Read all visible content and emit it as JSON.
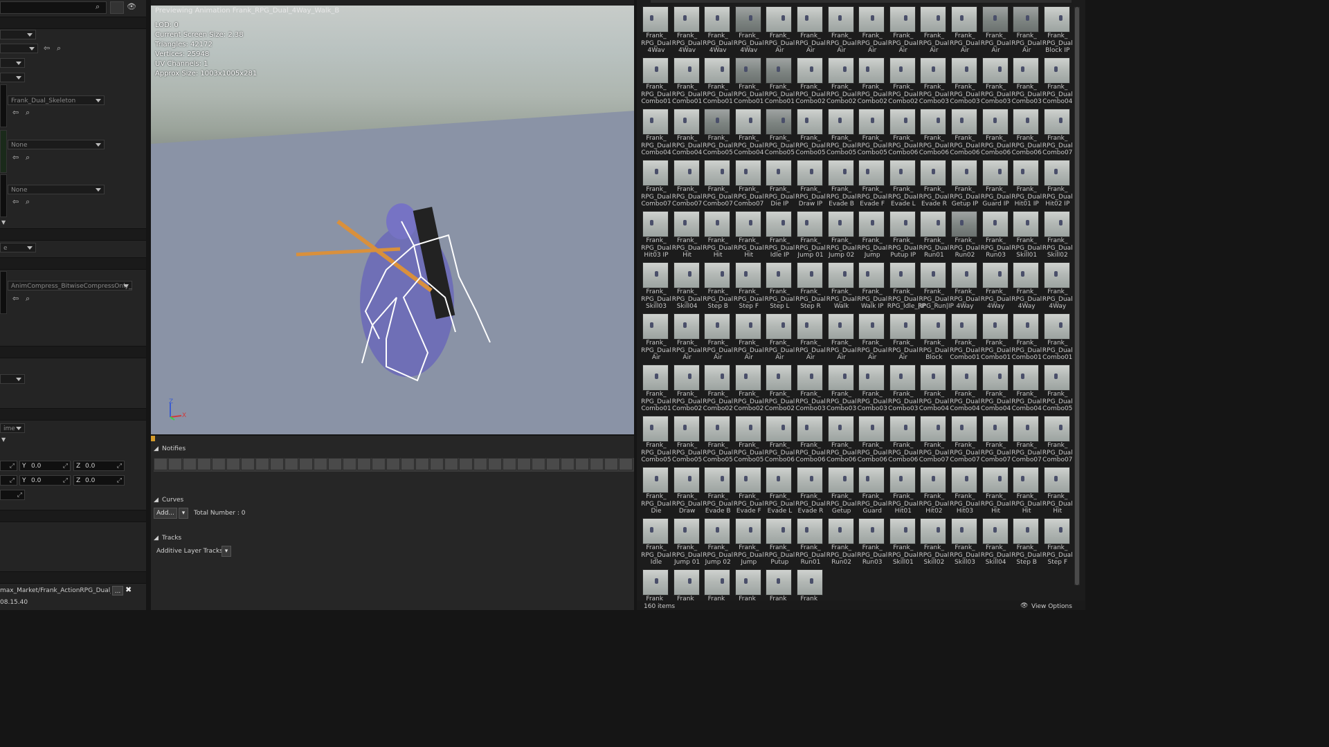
{
  "details": {
    "skeleton_value": "Frank_Dual_Skeleton",
    "none1": "None",
    "none2": "None",
    "compression_value": "AnimCompress_BitwiseCompressOnly_",
    "time_dropdown": "ime",
    "y1": "0.0",
    "z1": "0.0",
    "y2": "0.0",
    "z2": "0.0",
    "y_label": "Y",
    "z_label": "Z",
    "asset_path": "max_Market/Frank_ActionRPG_Dual_M",
    "timestamp": "08.15.40",
    "close_glyph": "✖",
    "browse_glyph": "..."
  },
  "viewport": {
    "title": "Previewing Animation Frank_RPG_Dual_4Way_Walk_B",
    "stats": [
      "LOD: 0",
      "Current Screen Size: 2.38",
      "Triangles: 42172",
      "Vertices: 25948",
      "UV Channels: 1",
      "Approx Size: 1003x1005x281"
    ],
    "axis": {
      "z": "Z",
      "x": "X"
    }
  },
  "anim": {
    "notifies": "Notifies",
    "curves": "Curves",
    "add": "Add...",
    "total": "Total Number : 0",
    "tracks": "Tracks",
    "additive": "Additive Layer Tracks"
  },
  "browser": {
    "item_count": "160 items",
    "view_options": "View Options",
    "tiles": [
      [
        "4Wav",
        "4Wav",
        "4Wav",
        "4Wav",
        "Air",
        "Air",
        "Air",
        "Air",
        "Air",
        "Air",
        "Air",
        "Air",
        "Air",
        "Block IP"
      ],
      [
        "Combo01",
        "Combo01",
        "Combo01",
        "Combo01",
        "Combo01",
        "Combo02",
        "Combo02",
        "Combo02",
        "Combo02",
        "Combo03",
        "Combo03",
        "Combo03",
        "Combo03",
        "Combo04"
      ],
      [
        "Combo04",
        "Combo04",
        "Combo05",
        "Combo04",
        "Combo05",
        "Combo05",
        "Combo05",
        "Combo05",
        "Combo06",
        "Combo06",
        "Combo06",
        "Combo06",
        "Combo06",
        "Combo07"
      ],
      [
        "Combo07",
        "Combo07",
        "Combo07",
        "Combo07",
        "Die IP",
        "Draw IP",
        "Evade B",
        "Evade F",
        "Evade L",
        "Evade R",
        "Getup IP",
        "Guard IP",
        "Hit01 IP",
        "Hit02 IP"
      ],
      [
        "Hit03 IP",
        "Hit",
        "Hit",
        "Hit",
        "Idle IP",
        "Jump 01",
        "Jump 02",
        "Jump",
        "Putup IP",
        "Run01",
        "Run02",
        "Run03",
        "Skill01",
        "Skill02"
      ],
      [
        "Skill03",
        "Skill04",
        "Step B",
        "Step F",
        "Step L",
        "Step R",
        "Walk",
        "Walk IP",
        "RPG_Idle_|IP",
        "RPG_Run|IP",
        "4Way",
        "4Way",
        "4Way",
        "4Way"
      ],
      [
        "Air",
        "Air",
        "Air",
        "Air",
        "Air",
        "Air",
        "Air",
        "Air",
        "Air",
        "Block",
        "Combo01",
        "Combo01",
        "Combo01",
        "Combo01"
      ],
      [
        "Combo01",
        "Combo02",
        "Combo02",
        "Combo02",
        "Combo02",
        "Combo03",
        "Combo03",
        "Combo03",
        "Combo03",
        "Combo04",
        "Combo04",
        "Combo04",
        "Combo04",
        "Combo05"
      ],
      [
        "Combo05",
        "Combo05",
        "Combo05",
        "Combo05",
        "Combo06",
        "Combo06",
        "Combo06",
        "Combo06",
        "Combo06",
        "Combo07",
        "Combo07",
        "Combo07",
        "Combo07",
        "Combo07"
      ],
      [
        "Die",
        "Draw",
        "Evade B",
        "Evade F",
        "Evade L",
        "Evade R",
        "Getup",
        "Guard",
        "Hit01",
        "Hit02",
        "Hit03",
        "Hit",
        "Hit",
        "Hit"
      ],
      [
        "Idle",
        "Jump 01",
        "Jump 02",
        "Jump",
        "Putup",
        "Run01",
        "Run02",
        "Run03",
        "Skill01",
        "Skill02",
        "Skill03",
        "Skill04",
        "Step B",
        "Step F"
      ],
      [
        "",
        "",
        "",
        "",
        "",
        ""
      ]
    ],
    "prefix1": "Frank_",
    "prefix2": "RPG_Dual"
  }
}
